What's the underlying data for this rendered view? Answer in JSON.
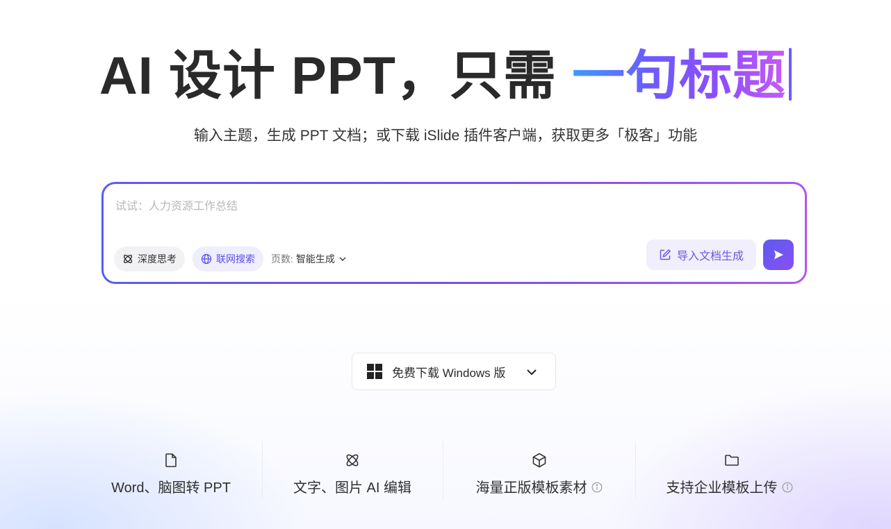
{
  "hero": {
    "title_plain": "AI 设计 PPT，只需 ",
    "title_highlight": "一句标题"
  },
  "subtitle": "输入主题，生成 PPT 文档；或下载 iSlide 插件客户端，获取更多「极客」功能",
  "prompt": {
    "placeholder": "试试：人力资源工作总结",
    "value": "",
    "deep_think_label": "深度思考",
    "web_search_label": "联网搜索",
    "pages_label": "页数:",
    "pages_value": "智能生成",
    "import_label": "导入文档生成"
  },
  "download": {
    "label": "免费下载 Windows 版"
  },
  "features": [
    {
      "icon": "file-icon",
      "label": "Word、脑图转 PPT",
      "info": false
    },
    {
      "icon": "atom-icon",
      "label": "文字、图片 AI 编辑",
      "info": false
    },
    {
      "icon": "cube-icon",
      "label": "海量正版模板素材",
      "info": true
    },
    {
      "icon": "folder-icon",
      "label": "支持企业模板上传",
      "info": true
    }
  ],
  "colors": {
    "gradient_start": "#3e9bff",
    "gradient_mid": "#6a5cff",
    "gradient_end": "#c55cf5",
    "accent": "#5a4fe6",
    "text": "#2a2a2a"
  }
}
